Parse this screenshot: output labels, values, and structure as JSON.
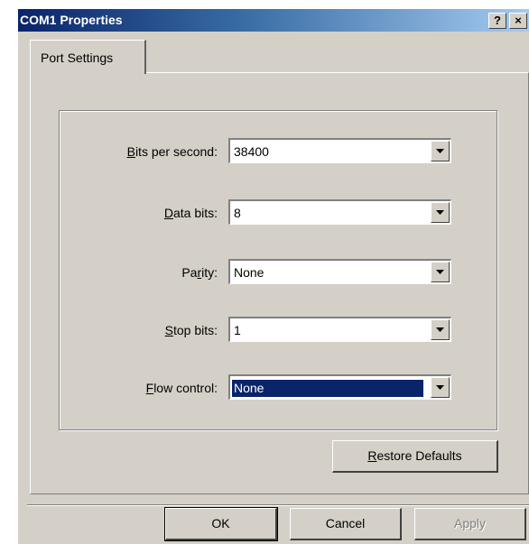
{
  "window": {
    "title": "COM1 Properties",
    "help_glyph": "?",
    "close_glyph": "×"
  },
  "tabs": [
    {
      "label": "Port Settings",
      "selected": true
    }
  ],
  "fields": [
    {
      "label_accel": "B",
      "label_rest": "its per second:",
      "value": "38400"
    },
    {
      "label_accel": "D",
      "label_rest": "ata bits:",
      "value": "8"
    },
    {
      "label_pre": "Pa",
      "label_accel": "r",
      "label_rest": "ity:",
      "value": "None"
    },
    {
      "label_accel": "S",
      "label_rest": "top bits:",
      "value": "1"
    },
    {
      "label_accel": "F",
      "label_rest": "low control:",
      "value": "None",
      "selected": true
    }
  ],
  "buttons": {
    "restore_accel": "R",
    "restore_rest": "estore Defaults",
    "ok": "OK",
    "cancel": "Cancel",
    "apply": "Apply"
  },
  "colors": {
    "title_start": "#0a246a",
    "title_end": "#a6caf0",
    "face": "#d4d0c8",
    "selection": "#0a246a"
  }
}
